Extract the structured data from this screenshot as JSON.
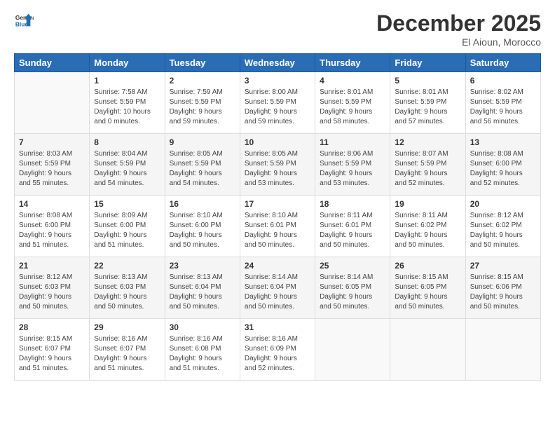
{
  "logo": {
    "general": "General",
    "blue": "Blue"
  },
  "header": {
    "month_year": "December 2025",
    "location": "El Aioun, Morocco"
  },
  "weekdays": [
    "Sunday",
    "Monday",
    "Tuesday",
    "Wednesday",
    "Thursday",
    "Friday",
    "Saturday"
  ],
  "weeks": [
    [
      {
        "day": "",
        "info": ""
      },
      {
        "day": "1",
        "info": "Sunrise: 7:58 AM\nSunset: 5:59 PM\nDaylight: 10 hours\nand 0 minutes."
      },
      {
        "day": "2",
        "info": "Sunrise: 7:59 AM\nSunset: 5:59 PM\nDaylight: 9 hours\nand 59 minutes."
      },
      {
        "day": "3",
        "info": "Sunrise: 8:00 AM\nSunset: 5:59 PM\nDaylight: 9 hours\nand 59 minutes."
      },
      {
        "day": "4",
        "info": "Sunrise: 8:01 AM\nSunset: 5:59 PM\nDaylight: 9 hours\nand 58 minutes."
      },
      {
        "day": "5",
        "info": "Sunrise: 8:01 AM\nSunset: 5:59 PM\nDaylight: 9 hours\nand 57 minutes."
      },
      {
        "day": "6",
        "info": "Sunrise: 8:02 AM\nSunset: 5:59 PM\nDaylight: 9 hours\nand 56 minutes."
      }
    ],
    [
      {
        "day": "7",
        "info": "Sunrise: 8:03 AM\nSunset: 5:59 PM\nDaylight: 9 hours\nand 55 minutes."
      },
      {
        "day": "8",
        "info": "Sunrise: 8:04 AM\nSunset: 5:59 PM\nDaylight: 9 hours\nand 54 minutes."
      },
      {
        "day": "9",
        "info": "Sunrise: 8:05 AM\nSunset: 5:59 PM\nDaylight: 9 hours\nand 54 minutes."
      },
      {
        "day": "10",
        "info": "Sunrise: 8:05 AM\nSunset: 5:59 PM\nDaylight: 9 hours\nand 53 minutes."
      },
      {
        "day": "11",
        "info": "Sunrise: 8:06 AM\nSunset: 5:59 PM\nDaylight: 9 hours\nand 53 minutes."
      },
      {
        "day": "12",
        "info": "Sunrise: 8:07 AM\nSunset: 5:59 PM\nDaylight: 9 hours\nand 52 minutes."
      },
      {
        "day": "13",
        "info": "Sunrise: 8:08 AM\nSunset: 6:00 PM\nDaylight: 9 hours\nand 52 minutes."
      }
    ],
    [
      {
        "day": "14",
        "info": "Sunrise: 8:08 AM\nSunset: 6:00 PM\nDaylight: 9 hours\nand 51 minutes."
      },
      {
        "day": "15",
        "info": "Sunrise: 8:09 AM\nSunset: 6:00 PM\nDaylight: 9 hours\nand 51 minutes."
      },
      {
        "day": "16",
        "info": "Sunrise: 8:10 AM\nSunset: 6:00 PM\nDaylight: 9 hours\nand 50 minutes."
      },
      {
        "day": "17",
        "info": "Sunrise: 8:10 AM\nSunset: 6:01 PM\nDaylight: 9 hours\nand 50 minutes."
      },
      {
        "day": "18",
        "info": "Sunrise: 8:11 AM\nSunset: 6:01 PM\nDaylight: 9 hours\nand 50 minutes."
      },
      {
        "day": "19",
        "info": "Sunrise: 8:11 AM\nSunset: 6:02 PM\nDaylight: 9 hours\nand 50 minutes."
      },
      {
        "day": "20",
        "info": "Sunrise: 8:12 AM\nSunset: 6:02 PM\nDaylight: 9 hours\nand 50 minutes."
      }
    ],
    [
      {
        "day": "21",
        "info": "Sunrise: 8:12 AM\nSunset: 6:03 PM\nDaylight: 9 hours\nand 50 minutes."
      },
      {
        "day": "22",
        "info": "Sunrise: 8:13 AM\nSunset: 6:03 PM\nDaylight: 9 hours\nand 50 minutes."
      },
      {
        "day": "23",
        "info": "Sunrise: 8:13 AM\nSunset: 6:04 PM\nDaylight: 9 hours\nand 50 minutes."
      },
      {
        "day": "24",
        "info": "Sunrise: 8:14 AM\nSunset: 6:04 PM\nDaylight: 9 hours\nand 50 minutes."
      },
      {
        "day": "25",
        "info": "Sunrise: 8:14 AM\nSunset: 6:05 PM\nDaylight: 9 hours\nand 50 minutes."
      },
      {
        "day": "26",
        "info": "Sunrise: 8:15 AM\nSunset: 6:05 PM\nDaylight: 9 hours\nand 50 minutes."
      },
      {
        "day": "27",
        "info": "Sunrise: 8:15 AM\nSunset: 6:06 PM\nDaylight: 9 hours\nand 50 minutes."
      }
    ],
    [
      {
        "day": "28",
        "info": "Sunrise: 8:15 AM\nSunset: 6:07 PM\nDaylight: 9 hours\nand 51 minutes."
      },
      {
        "day": "29",
        "info": "Sunrise: 8:16 AM\nSunset: 6:07 PM\nDaylight: 9 hours\nand 51 minutes."
      },
      {
        "day": "30",
        "info": "Sunrise: 8:16 AM\nSunset: 6:08 PM\nDaylight: 9 hours\nand 51 minutes."
      },
      {
        "day": "31",
        "info": "Sunrise: 8:16 AM\nSunset: 6:09 PM\nDaylight: 9 hours\nand 52 minutes."
      },
      {
        "day": "",
        "info": ""
      },
      {
        "day": "",
        "info": ""
      },
      {
        "day": "",
        "info": ""
      }
    ]
  ]
}
